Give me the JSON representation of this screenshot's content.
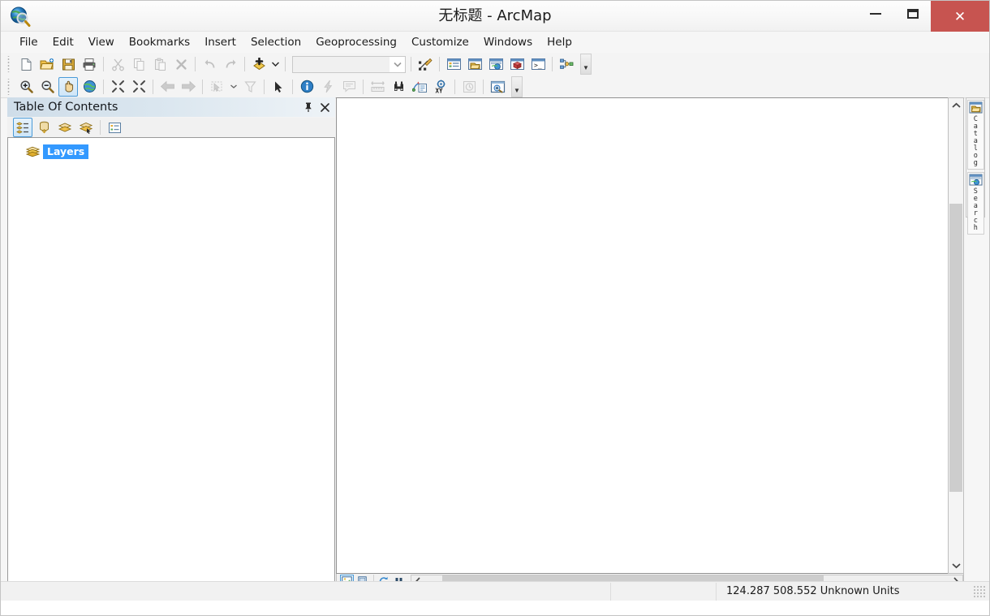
{
  "window": {
    "title": "无标题 - ArcMap",
    "app_icon": "arcmap-globe-magnifier-icon",
    "minimize_label": "",
    "maximize_label": "",
    "close_label": "✕"
  },
  "menubar": {
    "items": [
      {
        "label": "File"
      },
      {
        "label": "Edit"
      },
      {
        "label": "View"
      },
      {
        "label": "Bookmarks"
      },
      {
        "label": "Insert"
      },
      {
        "label": "Selection"
      },
      {
        "label": "Geoprocessing"
      },
      {
        "label": "Customize"
      },
      {
        "label": "Windows"
      },
      {
        "label": "Help"
      }
    ]
  },
  "standard_toolbar": {
    "buttons": [
      {
        "name": "new-map",
        "icon": "new-document-icon",
        "enabled": true
      },
      {
        "name": "open-map",
        "icon": "open-folder-icon",
        "enabled": true
      },
      {
        "name": "save-map",
        "icon": "floppy-save-icon",
        "enabled": true
      },
      {
        "name": "print-map",
        "icon": "printer-icon",
        "enabled": true
      },
      {
        "name": "cut",
        "icon": "scissors-icon",
        "enabled": false
      },
      {
        "name": "copy",
        "icon": "copy-pages-icon",
        "enabled": false
      },
      {
        "name": "paste",
        "icon": "clipboard-paste-icon",
        "enabled": false
      },
      {
        "name": "delete",
        "icon": "x-delete-icon",
        "enabled": false
      },
      {
        "name": "undo",
        "icon": "undo-arrow-icon",
        "enabled": false
      },
      {
        "name": "redo",
        "icon": "redo-arrow-icon",
        "enabled": false
      },
      {
        "name": "add-data",
        "icon": "add-data-diamond-icon",
        "enabled": true
      }
    ],
    "scale_combo": {
      "value": "",
      "placeholder": ""
    },
    "right_buttons": [
      {
        "name": "editor-toolbar",
        "icon": "editor-pencil-icon"
      },
      {
        "name": "table-of-contents-window",
        "icon": "toc-window-icon"
      },
      {
        "name": "catalog-window",
        "icon": "catalog-window-icon"
      },
      {
        "name": "search-window",
        "icon": "search-window-icon"
      },
      {
        "name": "arctoolbox-window",
        "icon": "arctoolbox-redbox-icon"
      },
      {
        "name": "python-window",
        "icon": "python-console-icon"
      },
      {
        "name": "modelbuilder-window",
        "icon": "modelbuilder-icon"
      }
    ],
    "overflow_label": "▼"
  },
  "tools_toolbar": {
    "buttons": [
      {
        "name": "zoom-in",
        "icon": "zoom-in-magnifier-icon",
        "enabled": true,
        "active": false
      },
      {
        "name": "zoom-out",
        "icon": "zoom-out-magnifier-icon",
        "enabled": true,
        "active": false
      },
      {
        "name": "pan",
        "icon": "pan-hand-icon",
        "enabled": true,
        "active": true
      },
      {
        "name": "full-extent",
        "icon": "globe-full-extent-icon",
        "enabled": true,
        "active": false
      },
      {
        "name": "fixed-zoom-in",
        "icon": "fixed-zoom-in-icon",
        "enabled": true,
        "active": false
      },
      {
        "name": "fixed-zoom-out",
        "icon": "fixed-zoom-out-icon",
        "enabled": true,
        "active": false
      },
      {
        "name": "go-back-extent",
        "icon": "arrow-left-icon",
        "enabled": false,
        "active": false
      },
      {
        "name": "go-forward-extent",
        "icon": "arrow-right-icon",
        "enabled": false,
        "active": false
      },
      {
        "name": "select-features",
        "icon": "select-features-icon",
        "enabled": false,
        "active": false
      },
      {
        "name": "clear-selection",
        "icon": "clear-selection-icon",
        "enabled": false,
        "active": false
      },
      {
        "name": "select-elements",
        "icon": "select-elements-arrow-icon",
        "enabled": true,
        "active": false
      },
      {
        "name": "identify",
        "icon": "identify-info-icon",
        "enabled": true,
        "active": false
      },
      {
        "name": "hyperlink",
        "icon": "hyperlink-lightning-icon",
        "enabled": false,
        "active": false
      },
      {
        "name": "html-popup",
        "icon": "html-popup-icon",
        "enabled": false,
        "active": false
      },
      {
        "name": "measure",
        "icon": "measure-ruler-icon",
        "enabled": false,
        "active": false
      },
      {
        "name": "find",
        "icon": "find-binoculars-icon",
        "enabled": true,
        "active": false
      },
      {
        "name": "find-route",
        "icon": "find-route-icon",
        "enabled": true,
        "active": false
      },
      {
        "name": "go-to-xy",
        "icon": "go-to-xy-icon",
        "enabled": true,
        "active": false
      },
      {
        "name": "time-slider",
        "icon": "time-slider-clock-icon",
        "enabled": false,
        "active": false
      },
      {
        "name": "create-viewer-window",
        "icon": "viewer-window-icon",
        "enabled": true,
        "active": false
      }
    ],
    "overflow_label": "▼"
  },
  "table_of_contents": {
    "title": "Table Of Contents",
    "pin_icon": "pin-icon",
    "close_icon": "close-icon",
    "toolbar_buttons": [
      {
        "name": "list-by-drawing-order",
        "icon": "list-drawing-order-icon",
        "active": true
      },
      {
        "name": "list-by-source",
        "icon": "list-by-source-icon",
        "active": false
      },
      {
        "name": "list-by-visibility",
        "icon": "list-by-visibility-icon",
        "active": false
      },
      {
        "name": "list-by-selection",
        "icon": "list-by-selection-icon",
        "active": false
      },
      {
        "name": "toc-options",
        "icon": "toc-options-icon",
        "active": false
      }
    ],
    "tree": [
      {
        "label": "Layers",
        "icon": "layers-stack-icon",
        "selected": true
      }
    ]
  },
  "map_view": {
    "background_color": "#ffffff",
    "vertical_scrollbar": {
      "up_arrow": "⌃",
      "down_arrow": "⌄"
    },
    "horizontal_scrollbar": {
      "left_arrow": "❮",
      "right_arrow": "❯"
    },
    "view_buttons": [
      {
        "name": "data-view",
        "icon": "data-view-icon",
        "active": true
      },
      {
        "name": "layout-view",
        "icon": "layout-view-icon",
        "active": false
      },
      {
        "name": "refresh-view",
        "icon": "refresh-icon",
        "active": false
      },
      {
        "name": "pause-drawing",
        "icon": "pause-icon",
        "active": false
      }
    ]
  },
  "dock_tabs": [
    {
      "label": "Catalog",
      "icon": "catalog-window-icon"
    },
    {
      "label": "Search",
      "icon": "search-window-icon"
    }
  ],
  "statusbar": {
    "coordinates": "124.287  508.552 Unknown Units",
    "resize_grip": "resize-grip-icon"
  },
  "colors": {
    "accent_blue": "#3399ff",
    "close_red": "#c75450",
    "toolbar_bg": "#f4f4f4",
    "toc_header_start": "#cfdde9",
    "scrollbar_thumb": "#cdcdcd"
  }
}
